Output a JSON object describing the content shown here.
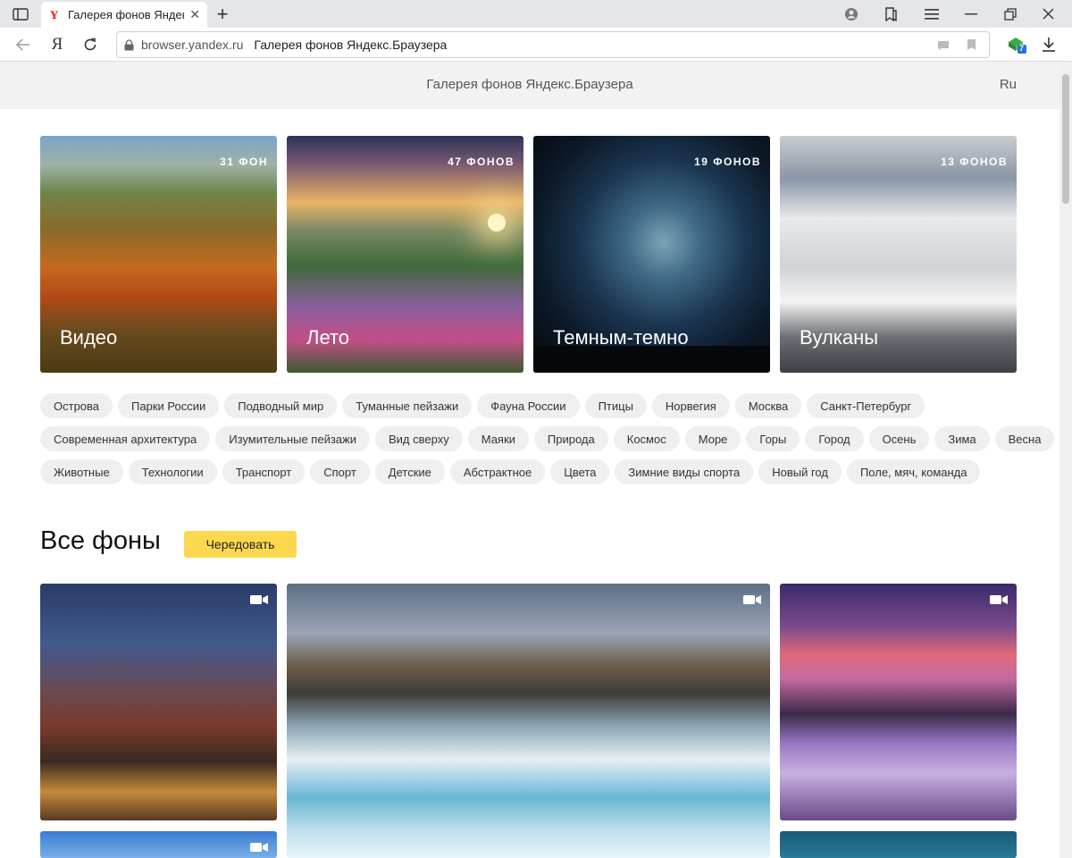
{
  "browser": {
    "tab_title": "Галерея фонов Яндекс.Браузера",
    "tab_favicon": "Y",
    "address_logo": "Я",
    "url_domain": "browser.yandex.ru",
    "url_title": "Галерея фонов Яндекс.Браузера",
    "extension_badge": "7"
  },
  "header": {
    "title": "Галерея фонов Яндекс.Браузера",
    "language": "Ru"
  },
  "categories": [
    {
      "name": "Видео",
      "count": "31 ФОН"
    },
    {
      "name": "Лето",
      "count": "47 ФОНОВ"
    },
    {
      "name": "Темным-темно",
      "count": "19 ФОНОВ"
    },
    {
      "name": "Вулканы",
      "count": "13 ФОНОВ"
    }
  ],
  "tags": {
    "row1": [
      "Острова",
      "Парки России",
      "Подводный мир",
      "Туманные пейзажи",
      "Фауна России",
      "Птицы",
      "Норвегия",
      "Москва",
      "Санкт-Петербург"
    ],
    "row2": [
      "Современная архитектура",
      "Изумительные пейзажи",
      "Вид сверху",
      "Маяки",
      "Природа",
      "Космос",
      "Море",
      "Горы",
      "Город",
      "Осень",
      "Зима",
      "Весна"
    ],
    "row3": [
      "Животные",
      "Технологии",
      "Транспорт",
      "Спорт",
      "Детские",
      "Абстрактное",
      "Цвета",
      "Зимние виды спорта",
      "Новый год",
      "Поле, мяч, команда"
    ]
  },
  "section": {
    "title": "Все фоны",
    "rotate_button": "Чередовать"
  },
  "colors": {
    "accent_yellow": "#fcd84f",
    "chip_bg": "#efefef",
    "header_bg": "#f2f2f2"
  }
}
